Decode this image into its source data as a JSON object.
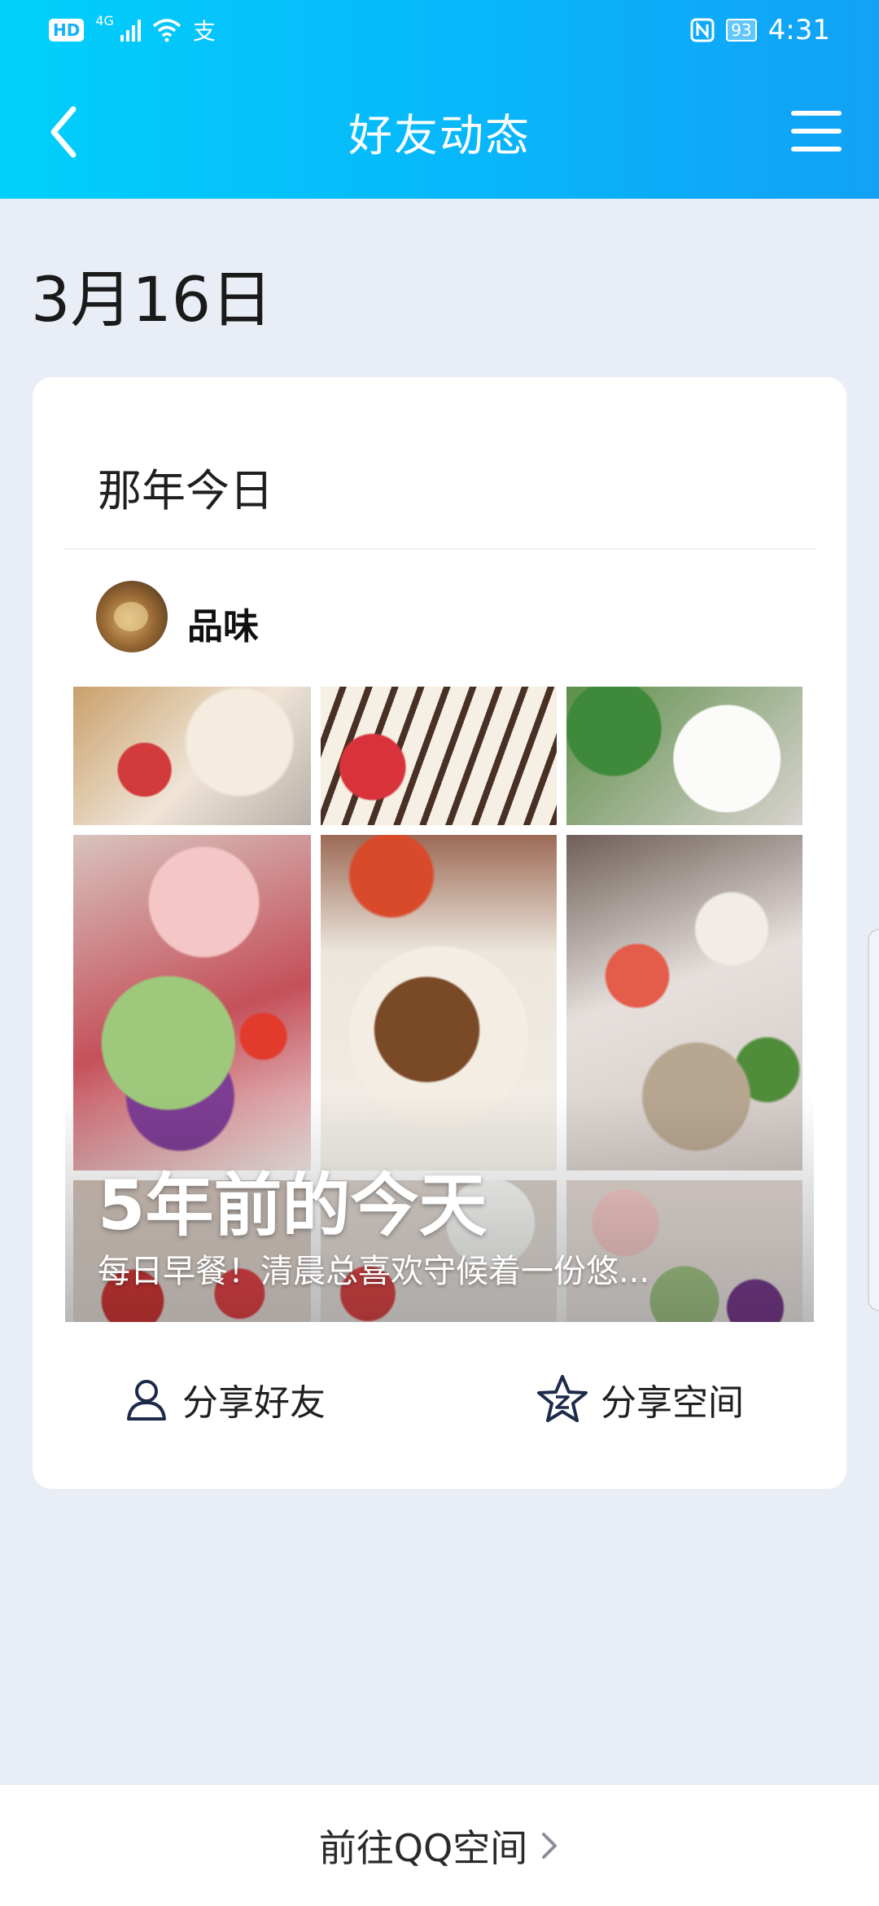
{
  "status_bar": {
    "hd": "HD",
    "network": "4G",
    "extra_icon": "支",
    "battery": "93",
    "time": "4:31",
    "icons": [
      "signal-icon",
      "wifi-icon",
      "nfc-icon",
      "battery-icon"
    ]
  },
  "nav": {
    "title": "好友动态",
    "back_icon": "chevron-left-icon",
    "menu_icon": "hamburger-menu-icon"
  },
  "date": "3月16日",
  "card": {
    "title": "那年今日",
    "user": {
      "name": "品味"
    },
    "collage": {
      "title": "5年前的今天",
      "description": "每日早餐！清晨总喜欢守候着一份悠..."
    },
    "actions": [
      {
        "label": "分享好友",
        "icon": "person-icon"
      },
      {
        "label": "分享空间",
        "icon": "star-z-icon"
      }
    ]
  },
  "footer": {
    "link_label": "前往QQ空间",
    "icon": "chevron-right-icon"
  },
  "colors": {
    "header_start": "#00d0fb",
    "header_end": "#12a1f6",
    "background": "#e9edf6",
    "card": "#ffffff"
  }
}
